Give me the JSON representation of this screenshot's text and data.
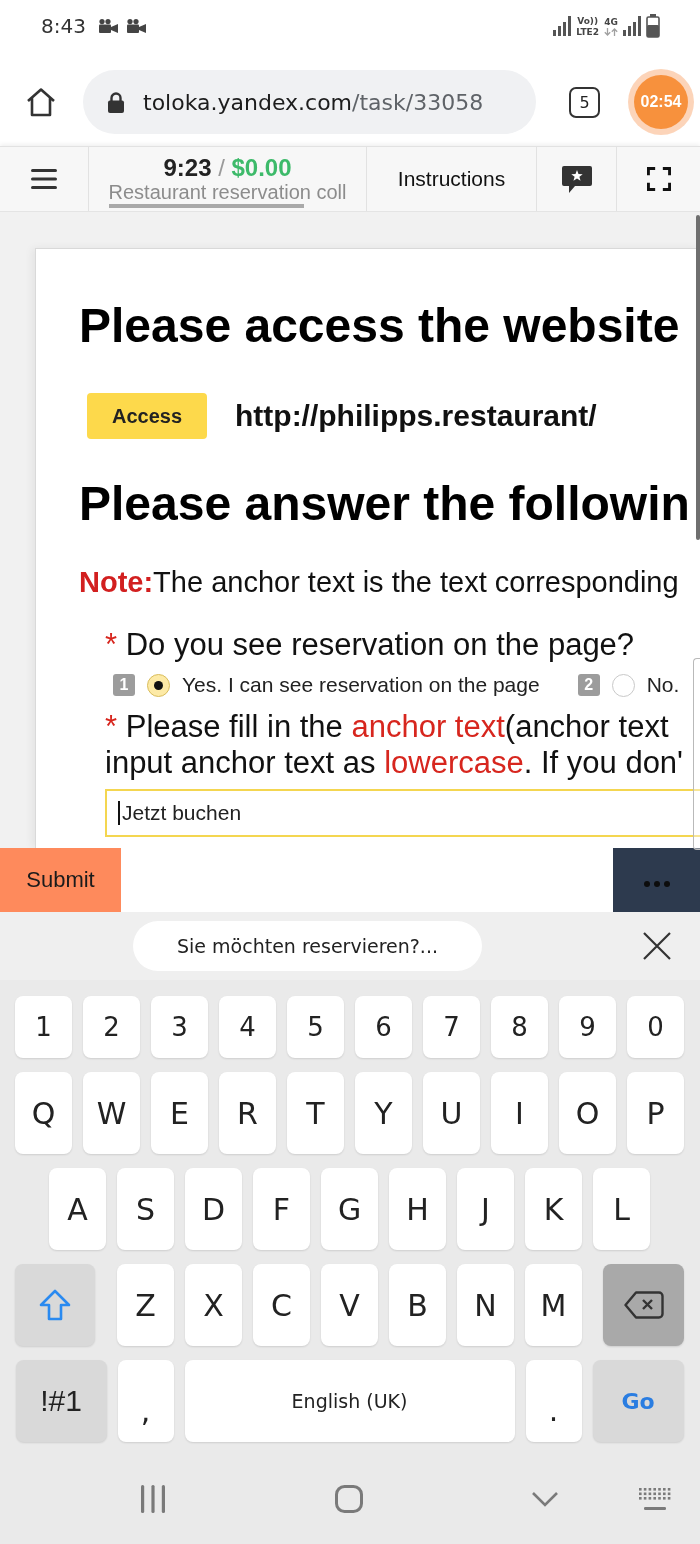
{
  "status_bar": {
    "time": "8:43",
    "volte": "Vo))",
    "lte": "LTE2",
    "network": "4G"
  },
  "browser": {
    "url_host": "toloka.yandex.com",
    "url_path": "/task/33058",
    "tab_count": "5",
    "timer": "02:54"
  },
  "toolbar": {
    "time_left": "9:23",
    "separator": "/",
    "earnings": "$0.00",
    "task_title": "Restaurant reservation coll",
    "instructions": "Instructions"
  },
  "task": {
    "heading_1": "Please access the website",
    "access_button": "Access",
    "website_url": "http://philipps.restaurant/",
    "heading_2": "Please answer the followin",
    "note": {
      "label": "Note:",
      "text": "The anchor text is the text corresponding"
    },
    "questions": [
      {
        "kind": "choice",
        "required_mark": "*",
        "lines": [
          [
            {
              "text": "Do you see reservation on the page?",
              "emphasis": false
            }
          ]
        ],
        "options": [
          {
            "key": "1",
            "label": "Yes. I can see reservation on the page",
            "selected": true
          },
          {
            "key": "2",
            "label": "No.",
            "selected": false
          }
        ]
      },
      {
        "kind": "text",
        "required_mark": "*",
        "lines": [
          [
            {
              "text": "Please fill in the ",
              "emphasis": false
            },
            {
              "text": "anchor text",
              "emphasis": true
            },
            {
              "text": "(anchor text",
              "emphasis": false
            }
          ],
          [
            {
              "text": "input anchor text as ",
              "emphasis": false
            },
            {
              "text": "lowercase",
              "emphasis": true
            },
            {
              "text": ". If you don'",
              "emphasis": false
            }
          ]
        ],
        "value": "Jetzt buchen"
      }
    ]
  },
  "footer": {
    "submit": "Submit"
  },
  "keyboard": {
    "suggestion": "Sie möchten reservieren?...",
    "rows": [
      {
        "keys": [
          {
            "kind": "digit",
            "label": "1"
          },
          {
            "kind": "digit",
            "label": "2"
          },
          {
            "kind": "digit",
            "label": "3"
          },
          {
            "kind": "digit",
            "label": "4"
          },
          {
            "kind": "digit",
            "label": "5"
          },
          {
            "kind": "digit",
            "label": "6"
          },
          {
            "kind": "digit",
            "label": "7"
          },
          {
            "kind": "digit",
            "label": "8"
          },
          {
            "kind": "digit",
            "label": "9"
          },
          {
            "kind": "digit",
            "label": "0"
          }
        ]
      },
      {
        "keys": [
          {
            "kind": "letter",
            "label": "Q"
          },
          {
            "kind": "letter",
            "label": "W"
          },
          {
            "kind": "letter",
            "label": "E"
          },
          {
            "kind": "letter",
            "label": "R"
          },
          {
            "kind": "letter",
            "label": "T"
          },
          {
            "kind": "letter",
            "label": "Y"
          },
          {
            "kind": "letter",
            "label": "U"
          },
          {
            "kind": "letter",
            "label": "I"
          },
          {
            "kind": "letter",
            "label": "O"
          },
          {
            "kind": "letter",
            "label": "P"
          }
        ]
      },
      {
        "keys": [
          {
            "kind": "letter",
            "label": "A"
          },
          {
            "kind": "letter",
            "label": "S"
          },
          {
            "kind": "letter",
            "label": "D"
          },
          {
            "kind": "letter",
            "label": "F"
          },
          {
            "kind": "letter",
            "label": "G"
          },
          {
            "kind": "letter",
            "label": "H"
          },
          {
            "kind": "letter",
            "label": "J"
          },
          {
            "kind": "letter",
            "label": "K"
          },
          {
            "kind": "letter",
            "label": "L"
          }
        ]
      },
      {
        "keys": [
          {
            "kind": "shift",
            "on": true
          },
          {
            "kind": "letter",
            "label": "Z"
          },
          {
            "kind": "letter",
            "label": "X"
          },
          {
            "kind": "letter",
            "label": "C"
          },
          {
            "kind": "letter",
            "label": "V"
          },
          {
            "kind": "letter",
            "label": "B"
          },
          {
            "kind": "letter",
            "label": "N"
          },
          {
            "kind": "letter",
            "label": "M"
          },
          {
            "kind": "backspace"
          }
        ]
      },
      {
        "keys": [
          {
            "kind": "symbols",
            "label": "!#1"
          },
          {
            "kind": "punct",
            "label": ","
          },
          {
            "kind": "space",
            "label": "English (UK)"
          },
          {
            "kind": "punct",
            "label": "."
          },
          {
            "kind": "action",
            "label": "Go"
          }
        ]
      }
    ]
  }
}
